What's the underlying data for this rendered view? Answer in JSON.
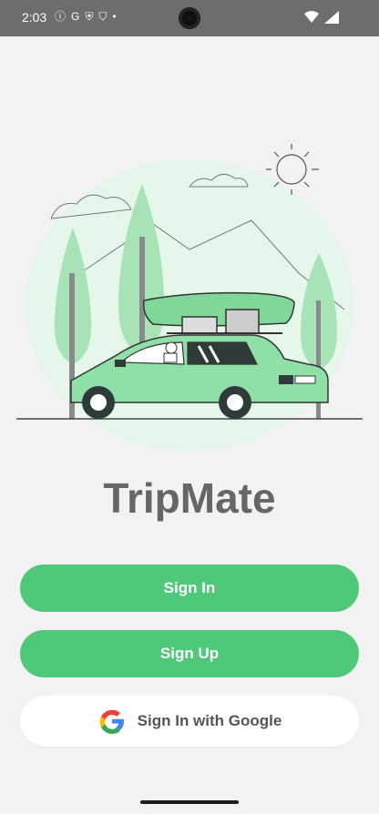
{
  "status": {
    "time": "2:03",
    "icons": [
      "info-icon",
      "google-icon",
      "shield-icon",
      "bolt-shield-icon",
      "dot-icon"
    ]
  },
  "app": {
    "title": "TripMate"
  },
  "buttons": {
    "sign_in": "Sign In",
    "sign_up": "Sign Up",
    "google_sign_in": "Sign In with Google"
  },
  "colors": {
    "accent": "#4fc979",
    "title_gray": "#666666",
    "background": "#f2f2f2"
  }
}
